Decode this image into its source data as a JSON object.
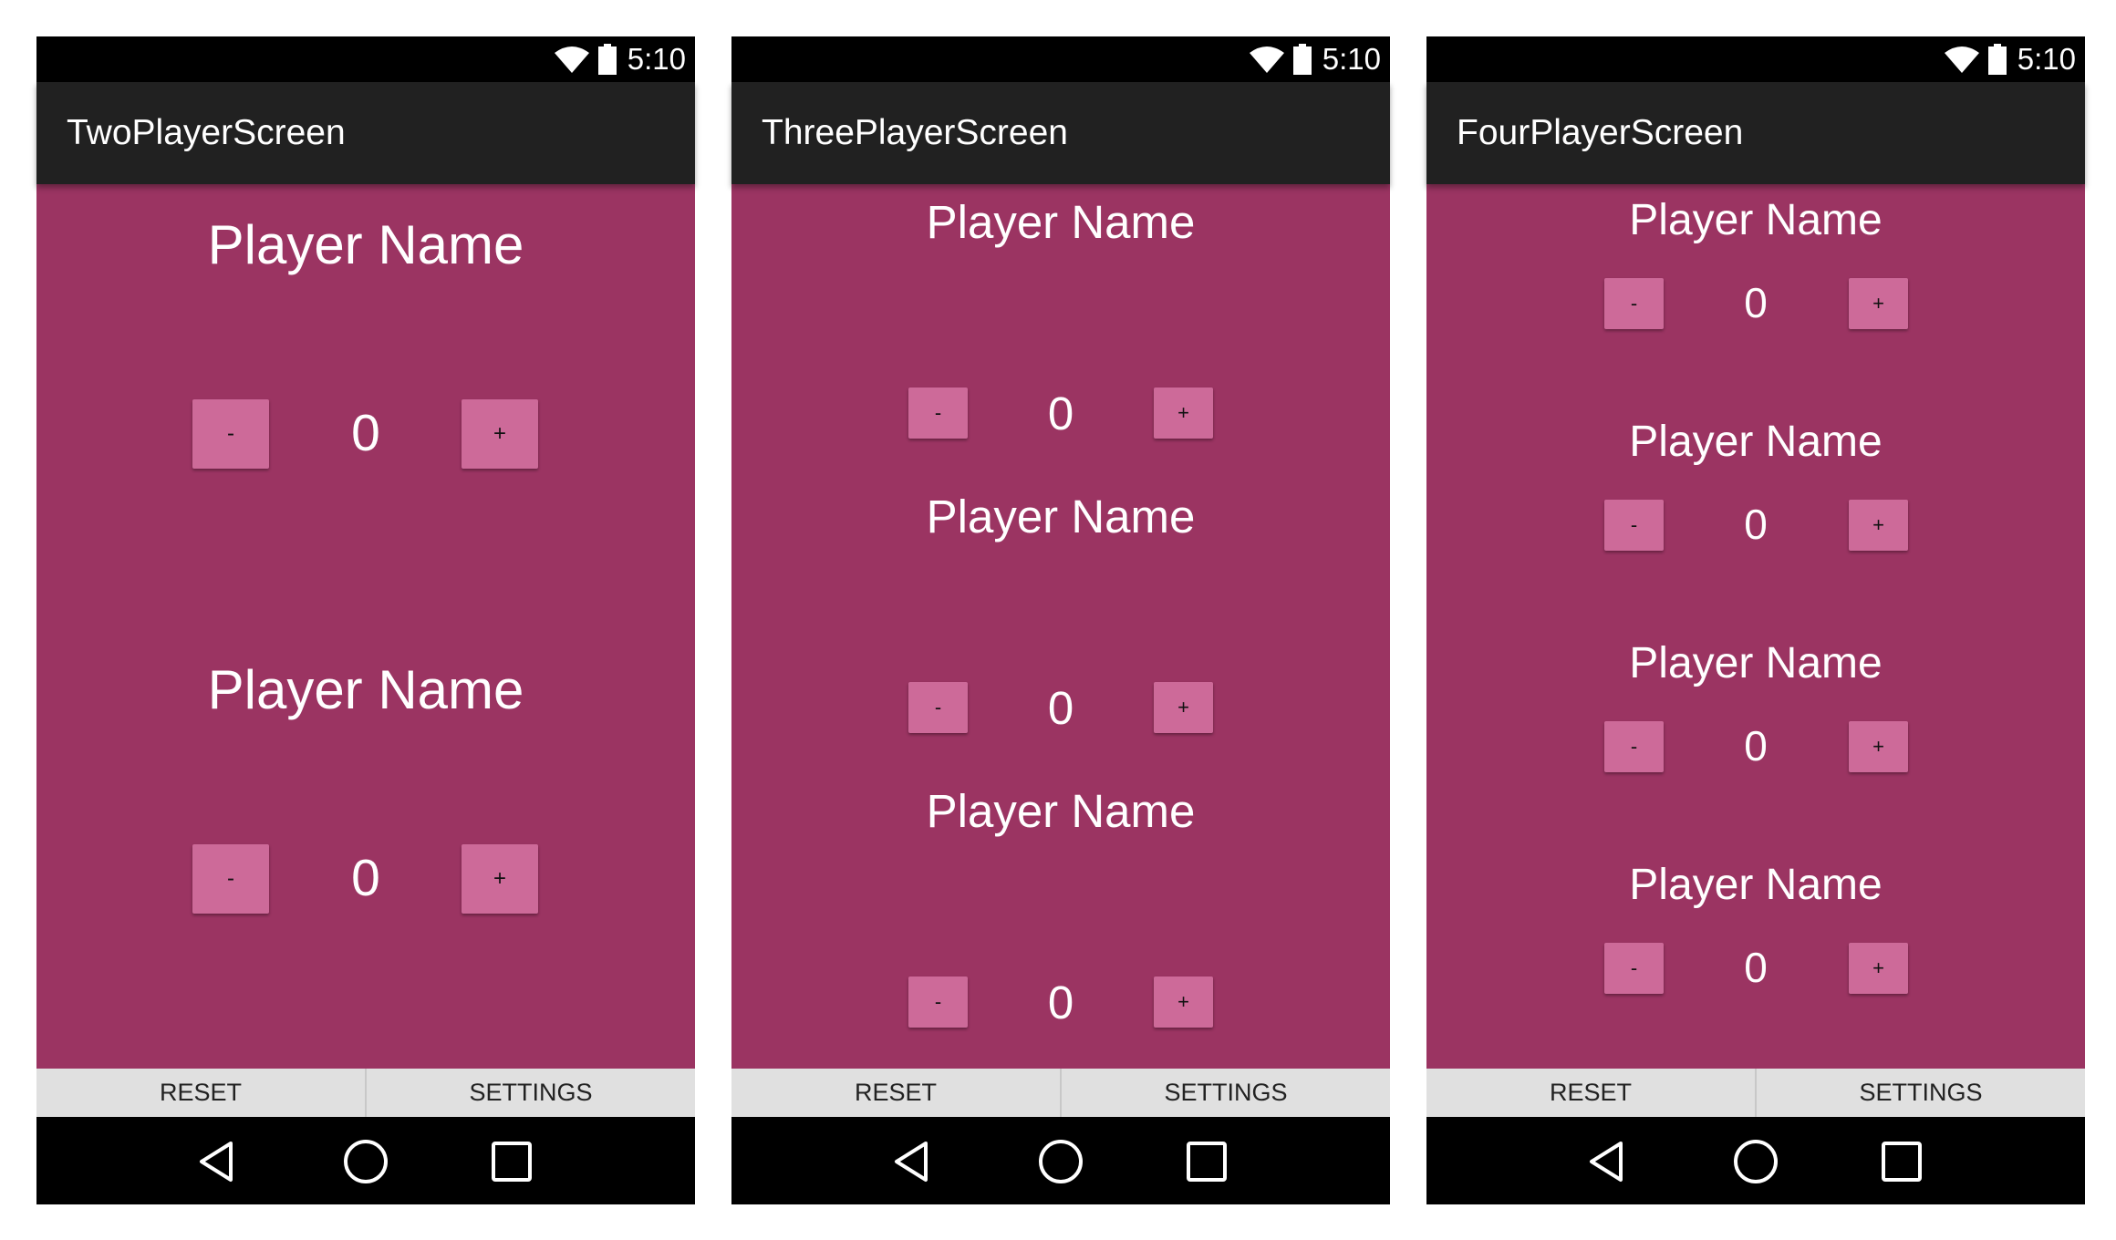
{
  "status_bar": {
    "time": "5:10",
    "icons": [
      "wifi-icon",
      "battery-icon"
    ]
  },
  "colors": {
    "background": "#9b3462",
    "button": "#cd6a99",
    "app_bar": "#212121",
    "bottom_bar": "#e0e0e0"
  },
  "bottom_bar": {
    "reset_label": "RESET",
    "settings_label": "SETTINGS"
  },
  "nav_bar": {
    "icons": [
      "back-icon",
      "home-icon",
      "recents-icon"
    ]
  },
  "screens": [
    {
      "title": "TwoPlayerScreen",
      "players": [
        {
          "name": "Player Name",
          "score": "0",
          "minus": "-",
          "plus": "+"
        },
        {
          "name": "Player Name",
          "score": "0",
          "minus": "-",
          "plus": "+"
        }
      ]
    },
    {
      "title": "ThreePlayerScreen",
      "players": [
        {
          "name": "Player Name",
          "score": "0",
          "minus": "-",
          "plus": "+"
        },
        {
          "name": "Player Name",
          "score": "0",
          "minus": "-",
          "plus": "+"
        },
        {
          "name": "Player Name",
          "score": "0",
          "minus": "-",
          "plus": "+"
        }
      ]
    },
    {
      "title": "FourPlayerScreen",
      "players": [
        {
          "name": "Player Name",
          "score": "0",
          "minus": "-",
          "plus": "+"
        },
        {
          "name": "Player Name",
          "score": "0",
          "minus": "-",
          "plus": "+"
        },
        {
          "name": "Player Name",
          "score": "0",
          "minus": "-",
          "plus": "+"
        },
        {
          "name": "Player Name",
          "score": "0",
          "minus": "-",
          "plus": "+"
        }
      ]
    }
  ]
}
